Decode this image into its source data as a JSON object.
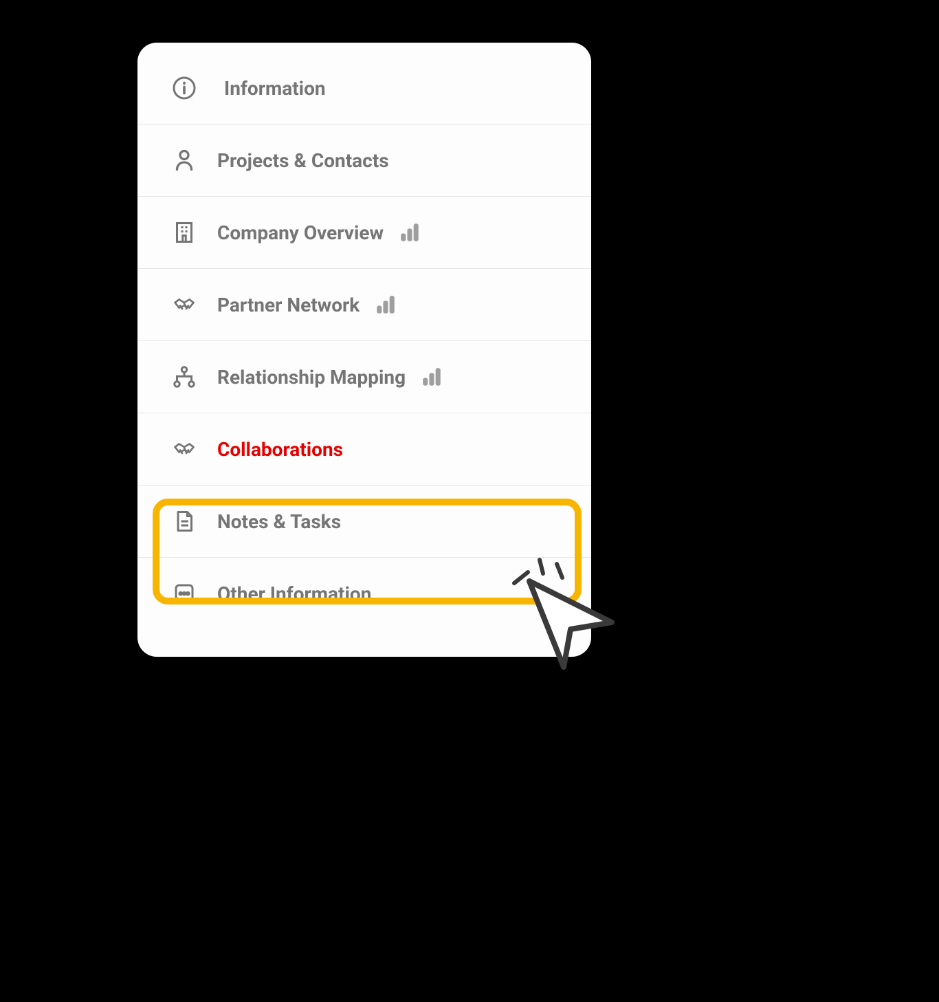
{
  "menu": {
    "items": [
      {
        "label": "Information",
        "icon": "info-circle-icon",
        "trailing": null,
        "active": false
      },
      {
        "label": "Projects & Contacts",
        "icon": "person-icon",
        "trailing": null,
        "active": false
      },
      {
        "label": "Company Overview",
        "icon": "building-icon",
        "trailing": "chart-icon",
        "active": false
      },
      {
        "label": "Partner Network",
        "icon": "handshake-icon",
        "trailing": "chart-icon",
        "active": false
      },
      {
        "label": "Relationship Mapping",
        "icon": "hierarchy-icon",
        "trailing": "chart-icon",
        "active": false
      },
      {
        "label": "Collaborations",
        "icon": "handshake-icon",
        "trailing": null,
        "active": true
      },
      {
        "label": "Notes & Tasks",
        "icon": "document-icon",
        "trailing": null,
        "active": false
      },
      {
        "label": "Other Information",
        "icon": "more-horizontal-icon",
        "trailing": null,
        "active": false
      }
    ]
  },
  "colors": {
    "highlight": "#f7b500",
    "active_text": "#e60000",
    "text": "#757575",
    "icon": "#757575"
  }
}
